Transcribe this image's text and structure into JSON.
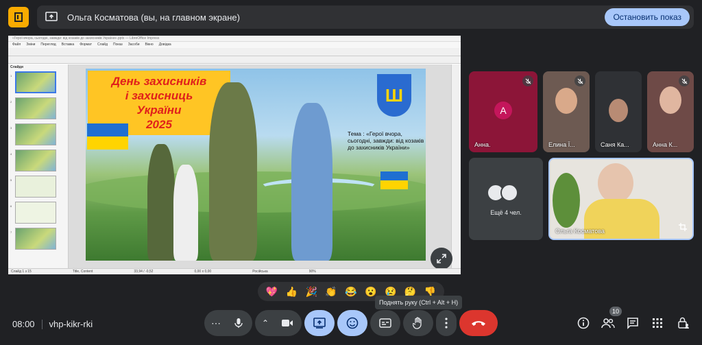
{
  "banner": {
    "title": "Ольга Косматова (вы, на главном экране)",
    "stop_label": "Остановить показ"
  },
  "shared_screen": {
    "window_title": "«Герої вчора, сьогодні, завжди: від козаків до захисників України».pptx — LibreOffice Impress",
    "menu": [
      "Файл",
      "Зміни",
      "Перегляд",
      "Вставка",
      "Формат",
      "Слайд",
      "Показ",
      "Засоби",
      "Вікно",
      "Довідка"
    ],
    "panel_title": "Слайди",
    "thumbnail_numbers": [
      "1",
      "2",
      "3",
      "4",
      "5",
      "6",
      "7"
    ],
    "status": {
      "slide": "Слайд 1 з 15",
      "layout": "Title, Content",
      "coords": "33,94 / -0,52",
      "size": "0,00 x 0,00",
      "language": "Російська",
      "zoom": "90%"
    },
    "slide": {
      "title_lines": [
        "День захисників",
        "і захисниць",
        "України",
        "2025"
      ],
      "topic_text": "Тема : «Герої вчора, сьогодні, завжди: від козаків до захисників України»"
    }
  },
  "participants": [
    {
      "name": "Анна.",
      "avatar_letter": "A",
      "muted": true
    },
    {
      "name": "Елина Ї...",
      "muted": true
    },
    {
      "name": "Саня Ка...",
      "muted": false
    },
    {
      "name": "Анна К...",
      "muted": true
    }
  ],
  "more_tile": {
    "label": "Ещё 4 чел."
  },
  "self_tile": {
    "name": "Ольга Косматова"
  },
  "reactions": [
    "💖",
    "👍",
    "🎉",
    "👏",
    "😂",
    "😮",
    "😢",
    "🤔",
    "👎"
  ],
  "tooltip": "Поднять руку (Ctrl + Alt + H)",
  "meeting": {
    "time": "08:00",
    "code": "vhp-kikr-rki"
  },
  "participants_count": "10",
  "colors": {
    "accent": "#a8c7fa",
    "end_call": "#dc362e",
    "background": "#202124"
  }
}
